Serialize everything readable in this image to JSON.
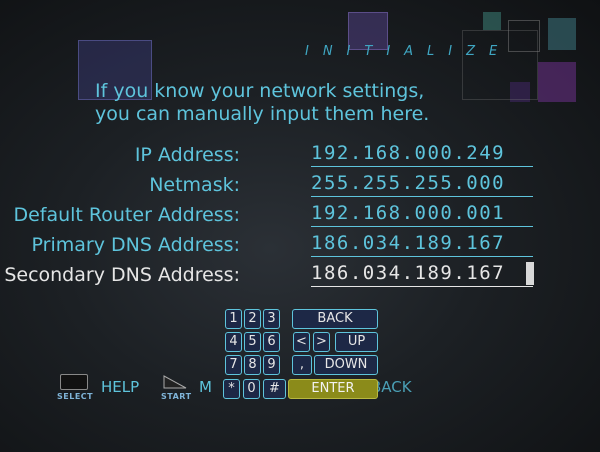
{
  "screen": {
    "title": "INITIALIZE",
    "intro_line1": "If you know your network settings,",
    "intro_line2": "you can manually input them here."
  },
  "fields": [
    {
      "label": "IP Address:",
      "value": "192.168.000.249"
    },
    {
      "label": "Netmask:",
      "value": "255.255.255.000"
    },
    {
      "label": "Default Router Address:",
      "value": "192.168.000.001"
    },
    {
      "label": "Primary DNS Address:",
      "value": "186.034.189.167"
    },
    {
      "label": "Secondary DNS Address:",
      "value": "186.034.189.167"
    }
  ],
  "keypad": {
    "k1": "1",
    "k2": "2",
    "k3": "3",
    "back": "BACK",
    "k4": "4",
    "k5": "5",
    "k6": "6",
    "left": "<",
    "right": ">",
    "up": "UP",
    "k7": "7",
    "k8": "8",
    "k9": "9",
    "comma": ",",
    "down": "DOWN",
    "star": "*",
    "k0": "0",
    "hash": "#",
    "enter": "ENTER"
  },
  "bottom_bar": {
    "select_caption": "SELECT",
    "help_label": "HELP",
    "start_caption": "START",
    "menu_partial": "M",
    "back_partial": "BACK"
  },
  "colors": {
    "accent_cyan": "#5ec4dc",
    "active_text": "#e6e6e6",
    "key_fill": "#1d2846",
    "enter_fill": "#8b8b1a"
  }
}
